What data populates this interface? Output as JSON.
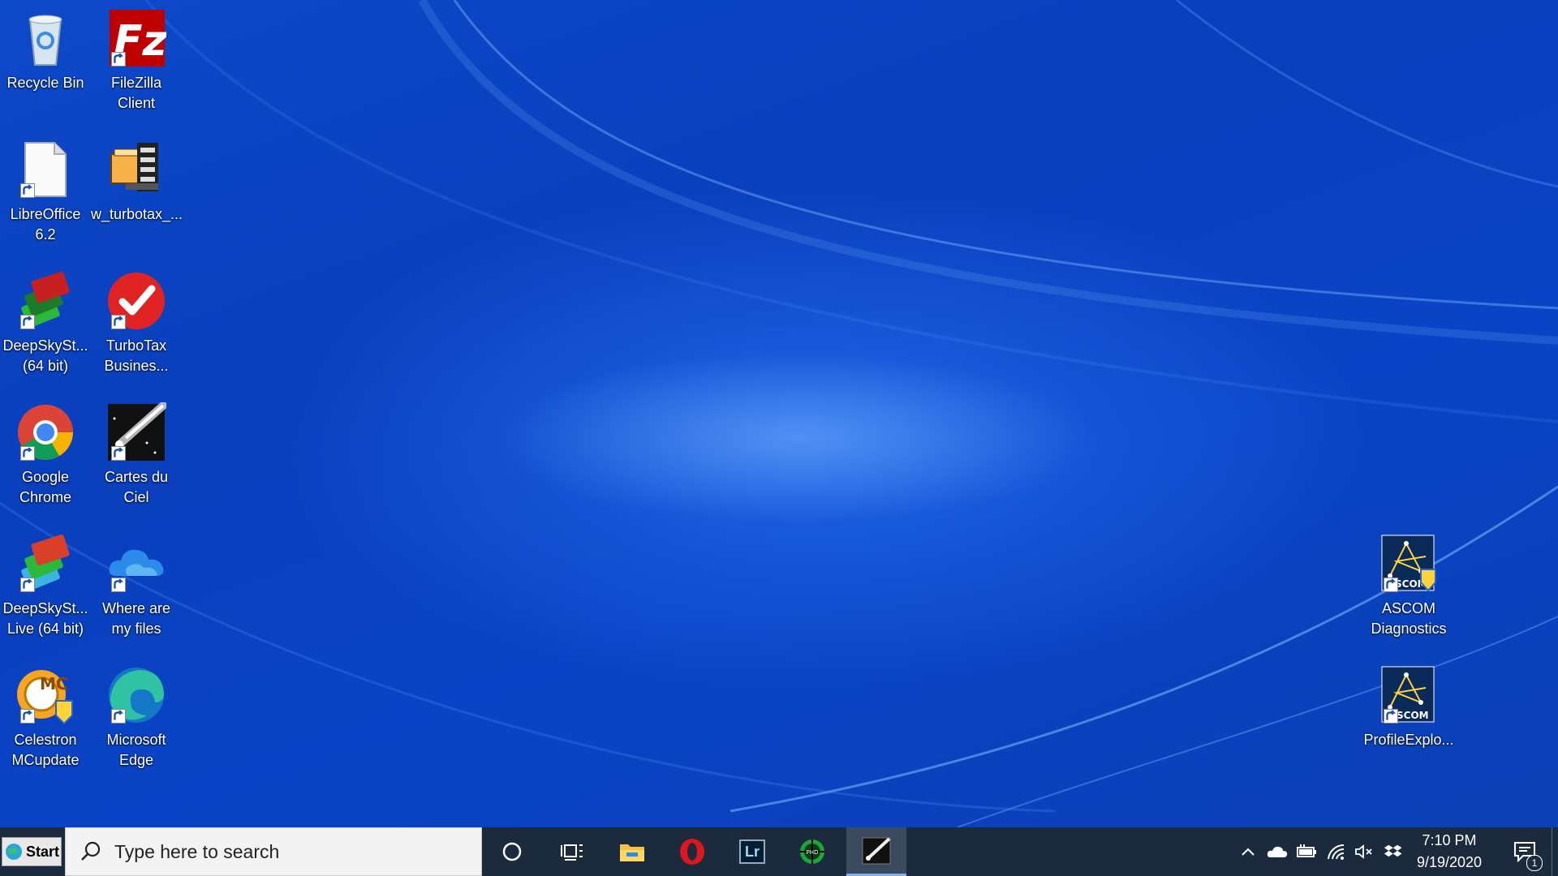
{
  "desktop": {
    "icons": {
      "recycle_bin": "Recycle Bin",
      "filezilla": "FileZilla Client",
      "libreoffice": "LibreOffice 6.2",
      "turbotax_file": "w_turbotax_...",
      "deepskystacker": "DeepSkySt... (64 bit)",
      "turbotax_business": "TurboTax Busines...",
      "chrome": "Google Chrome",
      "cartes_du_ciel": "Cartes du Ciel",
      "deepskystacker_live": "DeepSkySt... Live (64 bit)",
      "where_are_my_files": "Where are my files",
      "celestron": "Celestron MCupdate",
      "edge": "Microsoft Edge",
      "ascom_diagnostics": "ASCOM Diagnostics",
      "profile_explorer": "ProfileExplo..."
    },
    "badges": {
      "ascom": "SCOM",
      "mc": "MC",
      "phd": "PHD"
    },
    "colors": {
      "wallpaper": "#0a44c6",
      "taskbar": "#1b2a3d"
    }
  },
  "taskbar": {
    "start_label": "Start",
    "search_placeholder": "Type here to search",
    "pinned": [
      "cortana-icon",
      "task-view-icon",
      "file-explorer-icon",
      "opera-icon",
      "lightroom-icon",
      "phd-guiding-icon",
      "cartes-du-ciel-icon"
    ],
    "lightroom_label": "Lr",
    "clock_time": "7:10 PM",
    "clock_date": "9/19/2020",
    "notification_count": "1"
  }
}
